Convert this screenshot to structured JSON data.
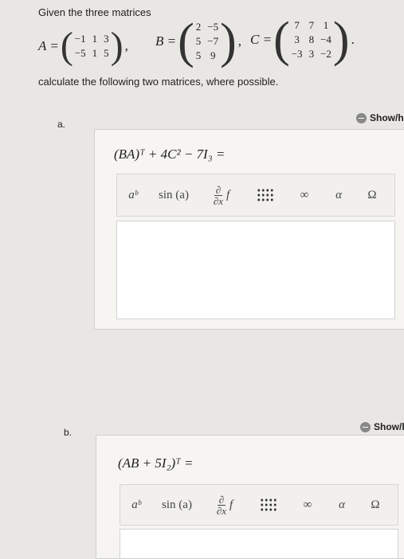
{
  "intro": "Given the three matrices",
  "matrices": {
    "A": {
      "label": "A =",
      "rows": [
        [
          "−1",
          "1",
          "3"
        ],
        [
          "−5",
          "1",
          "5"
        ]
      ]
    },
    "B": {
      "label": "B =",
      "rows": [
        [
          "2",
          "−5"
        ],
        [
          "5",
          "−7"
        ],
        [
          "5",
          "9"
        ]
      ]
    },
    "C": {
      "label": "C =",
      "rows": [
        [
          "7",
          "7",
          "1"
        ],
        [
          "3",
          "8",
          "−4"
        ],
        [
          "−3",
          "3",
          "−2"
        ]
      ]
    }
  },
  "instruction": "calculate the following two matrices, where possible.",
  "parts": [
    {
      "label": "a.",
      "show_label": "Show/h",
      "expression": "(BA)ᵀ + 4C² − 7I₃ =",
      "toolbar": {
        "power": "aᵇ",
        "sin": "sin (a)",
        "deriv_num": "∂",
        "deriv_den": "∂x",
        "deriv_f": "f",
        "infinity": "∞",
        "alpha": "α",
        "omega": "Ω"
      }
    },
    {
      "label": "b.",
      "show_label": "Show/l",
      "expression": "(AB + 5I₂)ᵀ =",
      "toolbar": {
        "power": "aᵇ",
        "sin": "sin (a)",
        "deriv_num": "∂",
        "deriv_den": "∂x",
        "deriv_f": "f",
        "infinity": "∞",
        "alpha": "α",
        "omega": "Ω"
      }
    }
  ]
}
